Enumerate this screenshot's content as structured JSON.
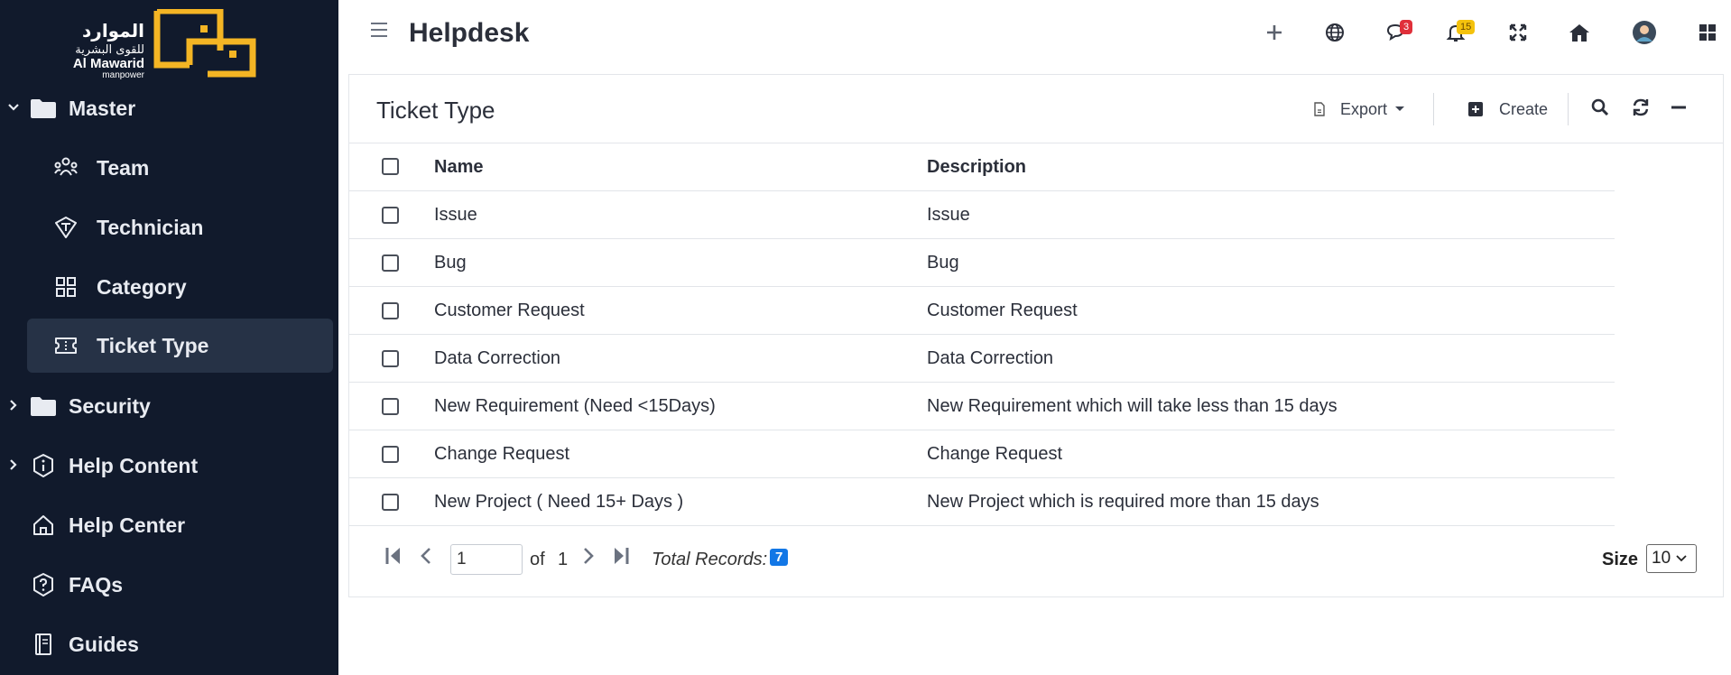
{
  "brand": {
    "arabic_line1": "الموارد",
    "arabic_line2": "للقوى البشرية",
    "english_line1": "Al Mawarid",
    "english_line2": "manpower"
  },
  "colors": {
    "sidebar_bg": "#111a2c",
    "active_item_bg": "#263246",
    "logo_yellow": "#f4b524",
    "badge_red": "#e0303a",
    "badge_yellow": "#f4c20d",
    "count_blue": "#1277e6"
  },
  "sidebar": {
    "items": [
      {
        "label": "Master",
        "icon": "folder-open-icon",
        "expanded": true
      },
      {
        "label": "Team",
        "icon": "team-icon"
      },
      {
        "label": "Technician",
        "icon": "technician-icon"
      },
      {
        "label": "Category",
        "icon": "category-grid-icon"
      },
      {
        "label": "Ticket Type",
        "icon": "ticket-icon",
        "active": true
      },
      {
        "label": "Security",
        "icon": "folder-icon",
        "expanded": false
      },
      {
        "label": "Help Content",
        "icon": "info-shield-icon",
        "expanded": false
      },
      {
        "label": "Help Center",
        "icon": "home-outline-icon"
      },
      {
        "label": "FAQs",
        "icon": "question-shield-icon"
      },
      {
        "label": "Guides",
        "icon": "book-icon"
      }
    ]
  },
  "header": {
    "title": "Helpdesk",
    "messages_badge": "3",
    "notifications_badge": "15",
    "icons": [
      "plus-icon",
      "globe-icon",
      "chat-icon",
      "bell-icon",
      "fullscreen-icon",
      "home-icon",
      "user-avatar",
      "apps-grid-icon"
    ]
  },
  "card": {
    "title": "Ticket Type",
    "export_label": "Export",
    "create_label": "Create"
  },
  "table": {
    "columns": [
      "Name",
      "Description"
    ],
    "rows": [
      [
        "Issue",
        "Issue"
      ],
      [
        "Bug",
        "Bug"
      ],
      [
        "Customer Request",
        "Customer Request"
      ],
      [
        "Data Correction",
        "Data Correction"
      ],
      [
        "New Requirement (Need <15Days)",
        "New Requirement which will take less than 15 days"
      ],
      [
        "Change Request",
        "Change Request"
      ],
      [
        "New Project ( Need 15+ Days )",
        "New Project which is required more than 15 days"
      ]
    ]
  },
  "pagination": {
    "page": "1",
    "of_label": "of",
    "total_pages": "1",
    "total_records_label": "Total Records:",
    "total_records": "7",
    "size_label": "Size",
    "size_value": "10"
  }
}
